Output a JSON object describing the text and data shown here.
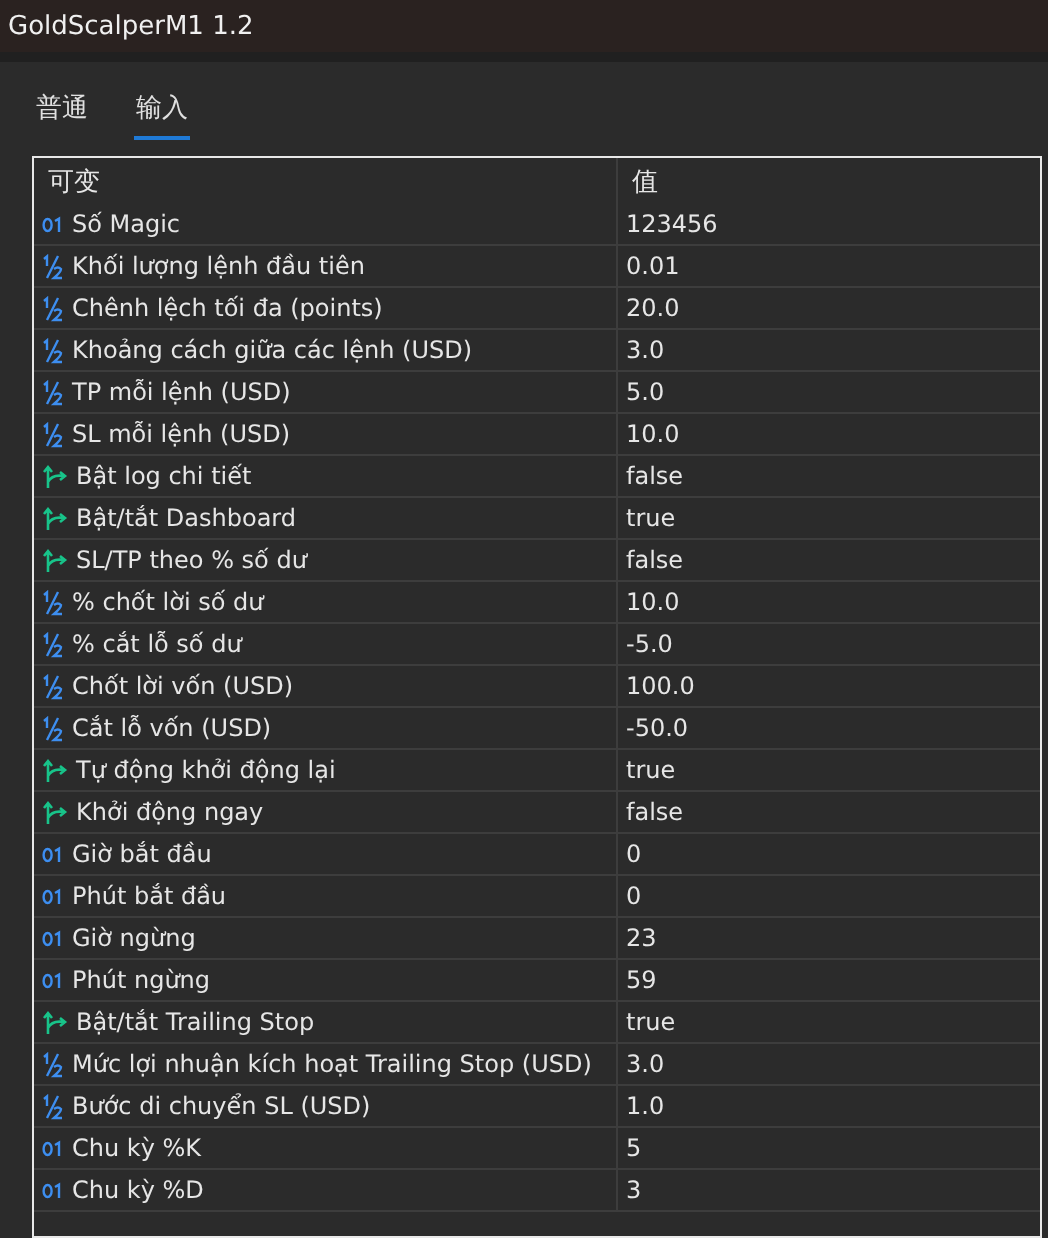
{
  "window": {
    "title": "GoldScalperM1 1.2"
  },
  "tabs": [
    {
      "label": "普通",
      "selected": false
    },
    {
      "label": "输入",
      "selected": true
    }
  ],
  "table": {
    "columns": [
      "可变",
      "值"
    ],
    "rows": [
      {
        "kind": "int",
        "name": "Số Magic",
        "value": "123456"
      },
      {
        "kind": "double",
        "name": "Khối lượng lệnh đầu tiên",
        "value": "0.01"
      },
      {
        "kind": "double",
        "name": "Chênh lệch tối đa (points)",
        "value": "20.0"
      },
      {
        "kind": "double",
        "name": "Khoảng cách giữa các lệnh (USD)",
        "value": "3.0"
      },
      {
        "kind": "double",
        "name": "TP mỗi lệnh (USD)",
        "value": "5.0"
      },
      {
        "kind": "double",
        "name": "SL mỗi lệnh (USD)",
        "value": "10.0"
      },
      {
        "kind": "bool",
        "name": "Bật log chi tiết",
        "value": "false"
      },
      {
        "kind": "bool",
        "name": "Bật/tắt Dashboard",
        "value": "true"
      },
      {
        "kind": "bool",
        "name": "SL/TP theo % số dư",
        "value": "false"
      },
      {
        "kind": "double",
        "name": "% chốt lời số dư",
        "value": "10.0"
      },
      {
        "kind": "double",
        "name": "% cắt lỗ số dư",
        "value": "-5.0"
      },
      {
        "kind": "double",
        "name": "Chốt lời vốn (USD)",
        "value": "100.0"
      },
      {
        "kind": "double",
        "name": "Cắt lỗ vốn (USD)",
        "value": "-50.0"
      },
      {
        "kind": "bool",
        "name": "Tự động khởi động lại",
        "value": "true"
      },
      {
        "kind": "bool",
        "name": "Khởi động ngay",
        "value": "false"
      },
      {
        "kind": "int",
        "name": "Giờ bắt đầu",
        "value": "0"
      },
      {
        "kind": "int",
        "name": "Phút bắt đầu",
        "value": "0"
      },
      {
        "kind": "int",
        "name": "Giờ ngừng",
        "value": "23"
      },
      {
        "kind": "int",
        "name": "Phút ngừng",
        "value": "59"
      },
      {
        "kind": "bool",
        "name": "Bật/tắt Trailing Stop",
        "value": "true"
      },
      {
        "kind": "double",
        "name": "Mức lợi nhuận kích hoạt Trailing Stop (USD)",
        "value": "3.0"
      },
      {
        "kind": "double",
        "name": "Bước di chuyển SL (USD)",
        "value": "1.0"
      },
      {
        "kind": "int",
        "name": "Chu kỳ %K",
        "value": "5"
      },
      {
        "kind": "int",
        "name": "Chu kỳ %D",
        "value": "3"
      }
    ]
  }
}
